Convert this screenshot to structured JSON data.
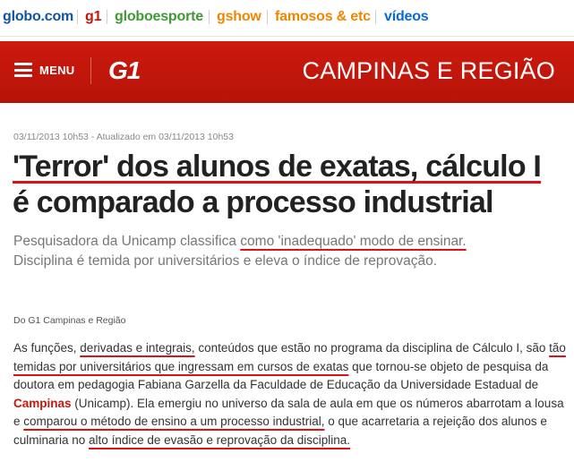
{
  "topnav": {
    "globo": "globo.com",
    "g1": "g1",
    "globoesporte": "globoesporte",
    "gshow": "gshow",
    "famosos": "famosos & etc",
    "videos": "vídeos"
  },
  "header": {
    "menu_label": "MENU",
    "logo_text": "G1",
    "region": "CAMPINAS E REGIÃO"
  },
  "article": {
    "meta": "03/11/2013 10h53 - Atualizado em 03/11/2013 10h53",
    "headline_a": "'Terror' dos alunos de exatas, cálculo I",
    "headline_b": "é comparado a processo industrial",
    "subtitle_a": "Pesquisadora da Unicamp classifica ",
    "subtitle_hl": "como 'inadequado' modo de ensinar.",
    "subtitle_b": "Disciplina é temida por universitários e eleva o índice de reprovação.",
    "byline": "Do G1 Campinas e Região",
    "p1": "As funções, ",
    "p2": "derivadas e integrais,",
    "p3": " conteúdos que estão no programa da disciplina de Cálculo I, são ",
    "p4": "tão temidas por universitários que ingressam em cursos de exatas",
    "p5": " que tornou-se objeto de pesquisa da doutora em pedagogia Fabiana Garzella da Faculdade de Educação da Universidade Estadual de ",
    "p6": "Campinas",
    "p7": " (Unicamp). Ela emergiu no universo da sala de aula em que os números abarrotam a lousa e ",
    "p8": "comparou o método de ensino a um processo industrial,",
    "p9": " o que acarretaria a rejeição dos alunos e culminaria no ",
    "p10": "alto índice de evasão e reprovação da disciplina."
  },
  "colors": {
    "g1_red": "#c4170c",
    "underline_red": "#e0101a",
    "globo_blue": "#1154a8",
    "ge_green": "#3f9935",
    "gshow_orange": "#f28500"
  },
  "icons": [
    "menu-icon"
  ]
}
